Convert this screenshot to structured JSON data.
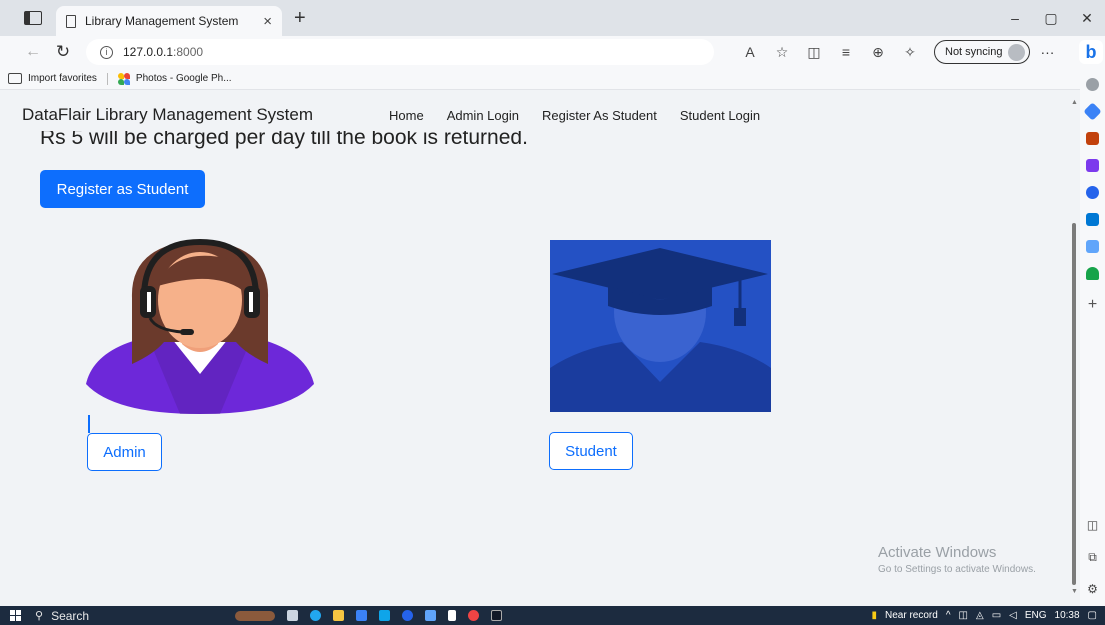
{
  "browser": {
    "tab_title": "Library Management System",
    "tab_close": "×",
    "new_tab": "+",
    "url_host": "127.0.0.1",
    "url_port": ":8000",
    "sync_label": "Not syncing",
    "more": "···",
    "bing": "b",
    "window_controls": {
      "minimize": "–",
      "restore": "▢",
      "close": "✕"
    }
  },
  "favorites": [
    {
      "label": "Import favorites",
      "icon": "folder-icon"
    },
    {
      "label": "Photos - Google Ph...",
      "icon": "google-photos-icon"
    }
  ],
  "page": {
    "brand": "DataFlair Library Management System",
    "nav": [
      "Home",
      "Admin Login",
      "Register As Student",
      "Student Login"
    ],
    "notice": "Rs 5 will be charged per day till the book is returned.",
    "register_button": "Register as Student",
    "admin_button": "Admin",
    "student_button": "Student"
  },
  "watermark": {
    "title": "Activate Windows",
    "subtitle": "Go to Settings to activate Windows."
  },
  "taskbar": {
    "search_label": "Search",
    "weather": "Near record",
    "language": "ENG",
    "time": "10:38"
  },
  "colors": {
    "primary": "#0d6efd",
    "page_bg": "#f1f3f6",
    "student_bg": "#2451c4",
    "admin_suit": "#7c3aed"
  }
}
